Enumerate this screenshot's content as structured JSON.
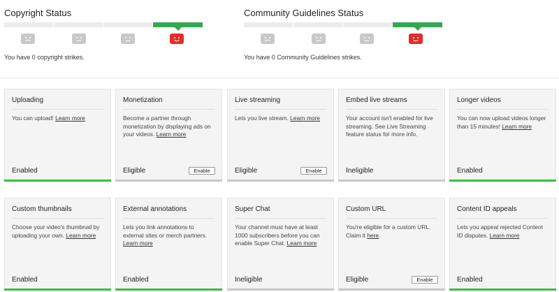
{
  "copyright": {
    "title": "Copyright Status",
    "message": "You have 0 copyright strikes.",
    "active_index": 3
  },
  "community": {
    "title": "Community Guidelines Status",
    "message": "You have 0 Community Guidelines strikes.",
    "active_index": 3
  },
  "features_row1": [
    {
      "title": "Uploading",
      "text": "You can upload! ",
      "link": "Learn more",
      "status": "Enabled",
      "button": ""
    },
    {
      "title": "Monetization",
      "text": "Become a partner through monetization by displaying ads on your videos. ",
      "link": "Learn more",
      "status": "Eligible",
      "button": "Enable"
    },
    {
      "title": "Live streaming",
      "text": "Lets you live stream. ",
      "link": "Learn more",
      "status": "Eligible",
      "button": "Enable"
    },
    {
      "title": "Embed live streams",
      "text": "Your account isn't enabled for live streaming. See Live Streaming feature status for more info.",
      "link": "",
      "status": "Ineligible",
      "button": ""
    },
    {
      "title": "Longer videos",
      "text": "You can now upload videos longer than 15 minutes! ",
      "link": "Learn more",
      "status": "Enabled",
      "button": ""
    }
  ],
  "features_row2": [
    {
      "title": "Custom thumbnails",
      "text": "Choose your video's thumbnail by uploading your own. ",
      "link": "Learn more",
      "status": "Enabled",
      "button": ""
    },
    {
      "title": "External annotations",
      "text": "Lets you link annotations to external sites or merch partners. ",
      "link": "Learn more",
      "status": "Enabled",
      "button": ""
    },
    {
      "title": "Super Chat",
      "text": "Your channel must have at least 1000 subscribers before you can enable Super Chat. ",
      "link": "Learn more",
      "status": "Ineligible",
      "button": ""
    },
    {
      "title": "Custom URL",
      "text": "You're eligible for a custom URL. Claim it ",
      "link": "here",
      "suffix": ".",
      "status": "Eligible",
      "button": "Enable"
    },
    {
      "title": "Content ID appeals",
      "text": "Lets you appeal rejected Content ID disputes. ",
      "link": "Learn more",
      "status": "Enabled",
      "button": ""
    }
  ],
  "colors": {
    "accent_green": "#33a852",
    "enabled_green": "#37c13a",
    "strike_red": "#e52d27",
    "inactive_gray": "#c8c8c8"
  }
}
